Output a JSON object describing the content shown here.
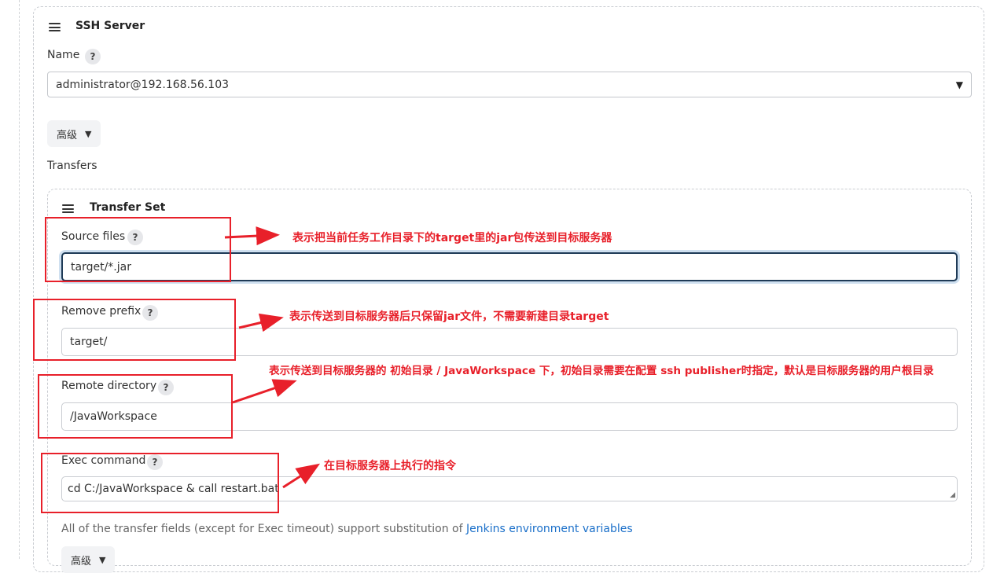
{
  "ssh_server": {
    "title": "SSH Server",
    "name_label": "Name",
    "name_value": "administrator@192.168.56.103",
    "advanced_label": "高级",
    "transfers_label": "Transfers"
  },
  "transfer_set": {
    "title": "Transfer Set",
    "source_files_label": "Source files",
    "source_files_value": "target/*.jar",
    "remove_prefix_label": "Remove prefix",
    "remove_prefix_value": "target/",
    "remote_directory_label": "Remote directory",
    "remote_directory_value": "/JavaWorkspace",
    "exec_command_label": "Exec command",
    "exec_command_value": "cd C:/JavaWorkspace & call restart.bat",
    "note_text": "All of the transfer fields (except for Exec timeout) support substitution of ",
    "note_link": "Jenkins environment variables",
    "advanced_label": "高级"
  },
  "help_symbol": "?",
  "annotations": {
    "source_files": "表示把当前任务工作目录下的target里的jar包传送到目标服务器",
    "remove_prefix": "表示传送到目标服务器后只保留jar文件，不需要新建目录target",
    "remote_directory": "表示传送到目标服务器的 初始目录 / JavaWorkspace 下，初始目录需要在配置 ssh publisher时指定，默认是目标服务器的用户根目录",
    "exec_command": "在目标服务器上执行的指令"
  },
  "colors": {
    "annotation_red": "#e8202a",
    "link_blue": "#1a6fc9",
    "focus_border": "#1f3b57"
  }
}
